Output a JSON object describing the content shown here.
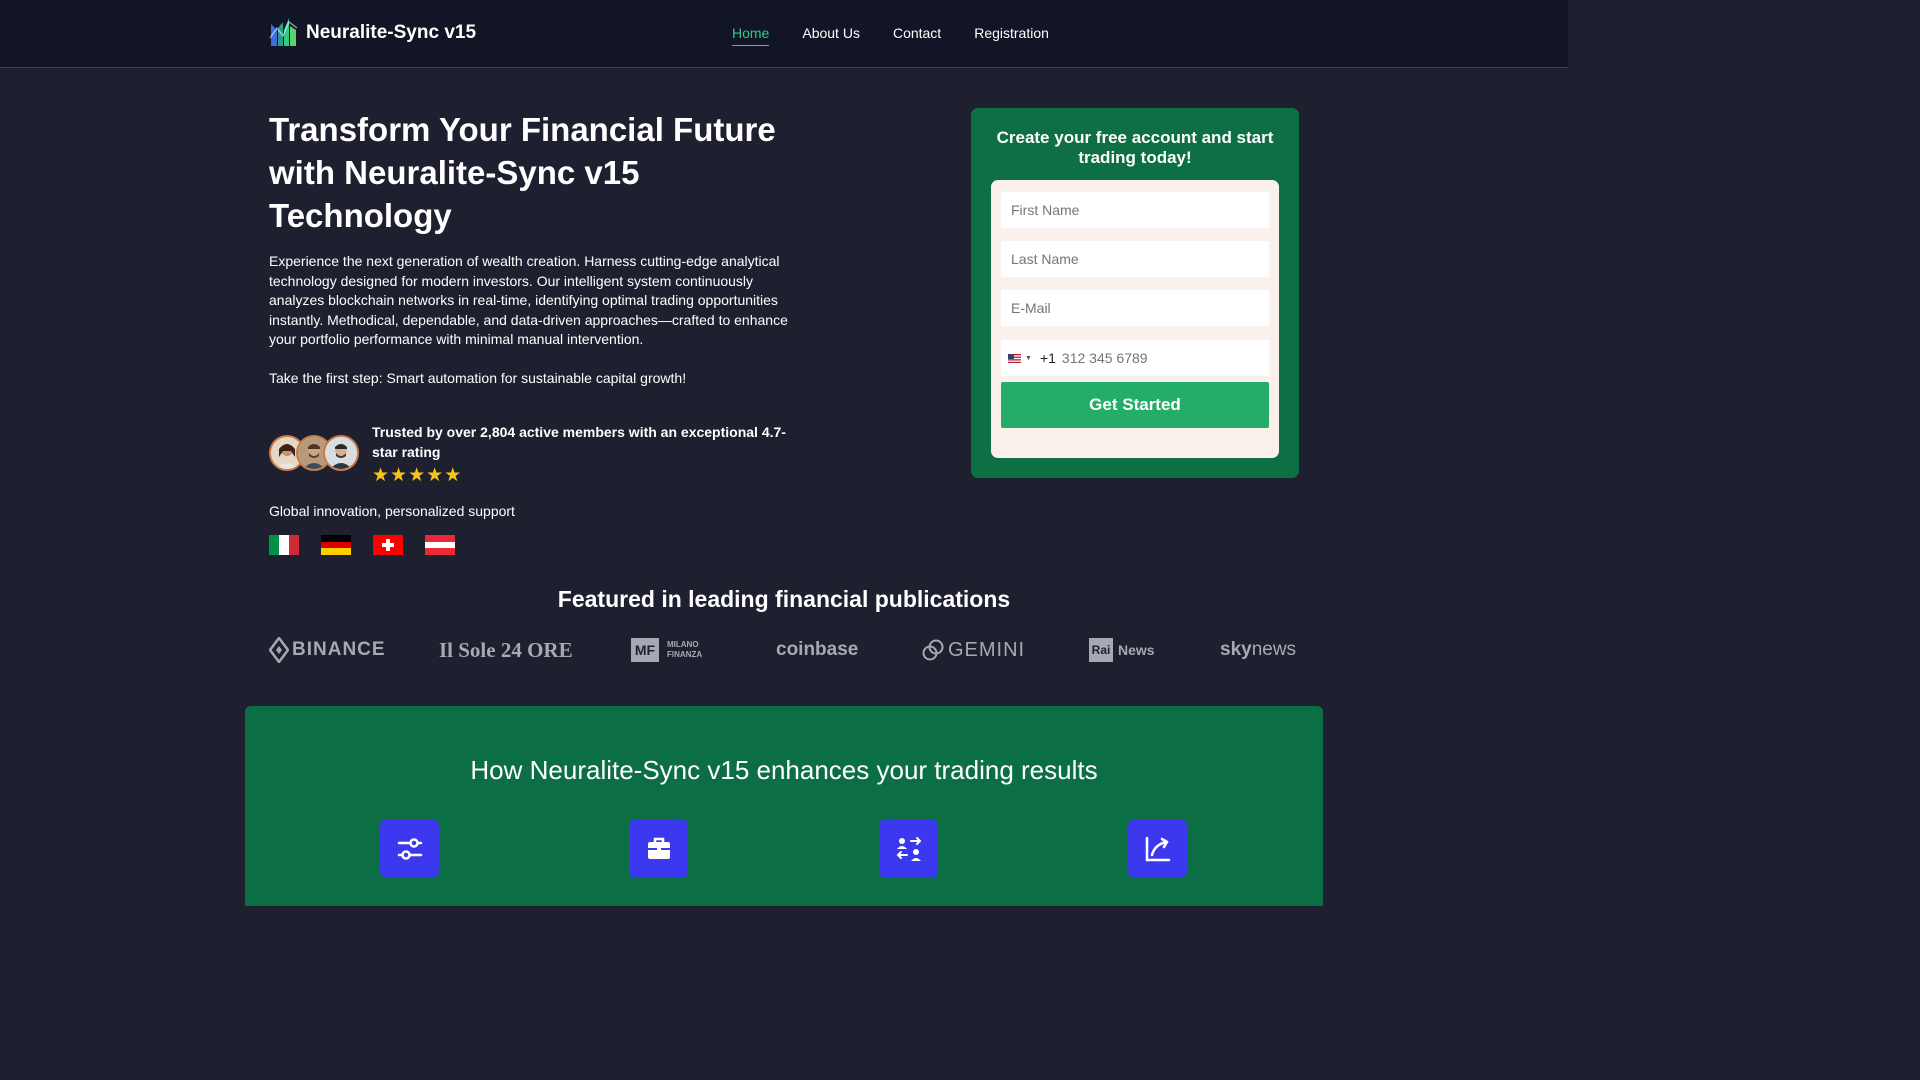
{
  "header": {
    "brand": "Neuralite-Sync v15",
    "nav": [
      {
        "label": "Home",
        "active": true
      },
      {
        "label": "About Us",
        "active": false
      },
      {
        "label": "Contact",
        "active": false
      },
      {
        "label": "Registration",
        "active": false
      }
    ]
  },
  "hero": {
    "title": "Transform Your Financial Future with Neuralite-Sync v15 Technology",
    "description": "Experience the next generation of wealth creation. Harness cutting-edge analytical technology designed for modern investors. Our intelligent system continuously analyzes blockchain networks in real-time, identifying optimal trading opportunities instantly. Methodical, dependable, and data-driven approaches—crafted to enhance your portfolio performance with minimal manual intervention.",
    "cta_text": "Take the first step: Smart automation for sustainable capital growth!",
    "trust_text": "Trusted by over 2,804 active members with an exceptional 4.7-star rating",
    "stars": 5,
    "global_text": "Global innovation, personalized support",
    "flags": [
      "italy-flag",
      "germany-flag",
      "switzerland-flag",
      "austria-flag"
    ]
  },
  "form": {
    "title": "Create your free account and start trading today!",
    "first_name_placeholder": "First Name",
    "last_name_placeholder": "Last Name",
    "email_placeholder": "E-Mail",
    "dial_code": "+1",
    "phone_placeholder": "312 345 6789",
    "submit_label": "Get Started"
  },
  "featured": {
    "title": "Featured in leading financial publications",
    "logos": {
      "binance": "BINANCE",
      "sole": "Il Sole 24 ORE",
      "mf_badge": "MF",
      "mf_line1": "MILANO",
      "mf_line2": "FINANZA",
      "coinbase": "coinbase",
      "gemini": "GEMINI",
      "rai_badge": "Rai",
      "rai_news": "News",
      "sky": "sky",
      "sky_news": "news"
    }
  },
  "features": {
    "title": "How Neuralite-Sync v15 enhances your trading results",
    "icons": [
      "sliders-icon",
      "briefcase-icon",
      "exchange-users-icon",
      "growth-arrow-icon"
    ]
  },
  "colors": {
    "background": "#1e2030",
    "header": "#111526",
    "accent_green": "#2ecc8a",
    "form_green": "#0e6e44",
    "button_green": "#24ad68",
    "icon_blue": "#3c38f0",
    "star": "#f5c518"
  }
}
